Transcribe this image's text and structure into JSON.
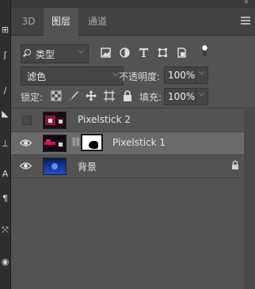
{
  "colors": {
    "panel_bg": "#535353",
    "tab_bar_bg": "#424242",
    "selected_layer": "#6a6a6a",
    "input_bg": "#454545"
  },
  "tabs": [
    {
      "label": "3D",
      "active": false
    },
    {
      "label": "图层",
      "active": true
    },
    {
      "label": "通道",
      "active": false
    }
  ],
  "filter": {
    "kind_label": "类型",
    "icons": [
      "image-filter-icon",
      "adjustment-filter-icon",
      "type-filter-icon",
      "shape-filter-icon",
      "smart-object-filter-icon"
    ]
  },
  "blend": {
    "mode": "滤色",
    "opacity_label": "不透明度:",
    "opacity_value": "100%"
  },
  "lock": {
    "label": "锁定:",
    "fill_label": "填充:",
    "fill_value": "100%"
  },
  "layers": [
    {
      "name": "Pixelstick 2",
      "visible": false,
      "selected": false
    },
    {
      "name": "Pixelstick 1",
      "visible": true,
      "selected": true,
      "has_mask": true
    },
    {
      "name": "背景",
      "visible": true,
      "selected": false,
      "locked": true
    }
  ]
}
